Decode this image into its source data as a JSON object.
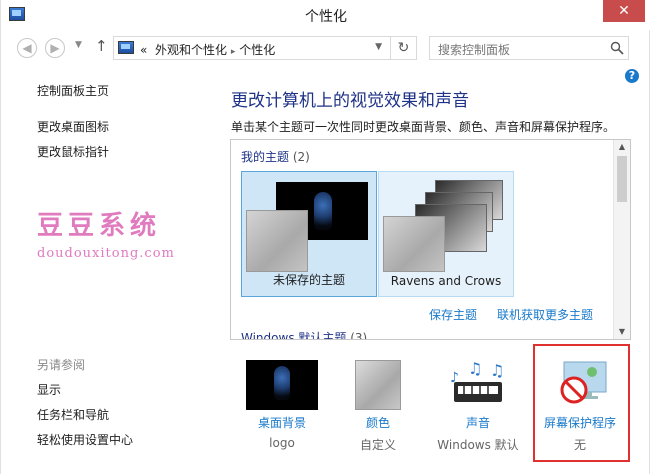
{
  "window": {
    "title": "个性化",
    "close_glyph": "✕"
  },
  "nav": {
    "back": "◀",
    "forward": "▶",
    "up": "↑",
    "dropdown": "▼",
    "breadcrumb": [
      "外观和个性化",
      "个性化"
    ],
    "breadcrumb_prefix": "«",
    "breadcrumb_sep": "▸",
    "refresh": "↻",
    "search_placeholder": "搜索控制面板"
  },
  "left_nav": {
    "items": [
      "控制面板主页",
      "更改桌面图标",
      "更改鼠标指针"
    ],
    "watermark_cn": "豆豆系统",
    "watermark_en": "doudouxitong.com",
    "see_also_header": "另请参阅",
    "see_also": [
      "显示",
      "任务栏和导航",
      "轻松使用设置中心"
    ]
  },
  "help_glyph": "?",
  "main": {
    "title": "更改计算机上的视觉效果和声音",
    "description": "单击某个主题可一次性同时更改桌面背景、颜色、声音和屏幕保护程序。"
  },
  "themes": {
    "my_themes_label": "我的主题",
    "my_themes_count": "(2)",
    "items": [
      {
        "label": "未保存的主题",
        "selected": true
      },
      {
        "label": "Ravens and Crows",
        "selected": false
      }
    ],
    "save_link": "保存主题",
    "online_link": "联机获取更多主题",
    "default_label": "Windows 默认主题",
    "default_count": "(3)"
  },
  "tiles": [
    {
      "label": "桌面背景",
      "sub": "logo",
      "icon": "desktop-background-icon"
    },
    {
      "label": "颜色",
      "sub": "自定义",
      "icon": "color-icon"
    },
    {
      "label": "声音",
      "sub": "Windows 默认",
      "icon": "sound-icon"
    },
    {
      "label": "屏幕保护程序",
      "sub": "无",
      "icon": "screensaver-icon"
    }
  ],
  "colors": {
    "accent_link": "#1979ca",
    "title_blue": "#1e3287",
    "highlight_red": "#e03030",
    "watermark_pink": "#e07bbf"
  }
}
